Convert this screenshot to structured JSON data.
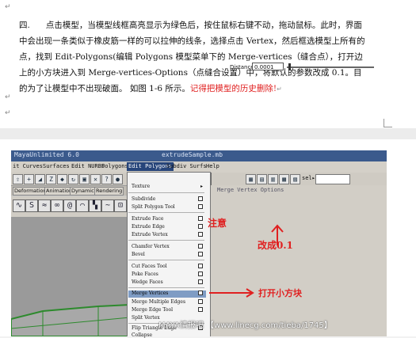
{
  "document": {
    "paragraph_number": "四.",
    "paragraph_text": "点击模型，当模型线框高亮显示为绿色后，按住鼠标右键不动，拖动鼠标。此时，界面中会出现一条类似于橡皮筋一样的可以拉伸的线条，选择点击 Vertex，然后框选模型上所有的点，找到 Edit-Polygons(编辑 Polygons 模型菜单下的 Merge-vertices（缝合点），打开边上的小方块进入到 Merge-vertices-Options（点缝合设置）中，将默认的参数改成 0.1。目的为了让模型中不出现破面。 如图 1-6 所示。",
    "red_note": "记得把模型的历史删除!",
    "return_mark": "↵"
  },
  "maya": {
    "window_title_left": "MayaUnlimited 6.0",
    "window_title_right": "extrudeSample.mb",
    "menus": [
      "it Curves",
      "Surfaces",
      "Edit NURBS",
      "Polygons",
      "Edit Polygons",
      "Subdiv Surfs",
      "Help"
    ],
    "active_menu": "Edit Polygons",
    "shelf_tabs": [
      "Deformation",
      "Animation",
      "Dynamics",
      "Rendering"
    ],
    "sel_label": "sel▸",
    "dialog_title": "Merge Vertex Options",
    "distance_label": "Distance",
    "distance_value": "0.0001",
    "menu_items": [
      {
        "label": "Texture",
        "type": "submenu"
      },
      {
        "label": "Subdivide",
        "type": "option"
      },
      {
        "label": "Split Polygon Tool",
        "type": "option"
      },
      {
        "label": "Extrude Face",
        "type": "option"
      },
      {
        "label": "Extrude Edge",
        "type": "option"
      },
      {
        "label": "Extrude Vertex",
        "type": "option"
      },
      {
        "label": "Chamfer Vertex",
        "type": "option"
      },
      {
        "label": "Bevel",
        "type": "option"
      },
      {
        "label": "Cut Faces Tool",
        "type": "option"
      },
      {
        "label": "Poke Faces",
        "type": "option"
      },
      {
        "label": "Wedge Faces",
        "type": "option"
      },
      {
        "label": "Merge Vertices",
        "type": "option",
        "highlight": true
      },
      {
        "label": "Merge Multiple Edges",
        "type": "option"
      },
      {
        "label": "Merge Edge Tool",
        "type": "option"
      },
      {
        "label": "Split Vertex",
        "type": "plain"
      },
      {
        "label": "Flip Triangle Edge",
        "type": "option"
      },
      {
        "label": "Collapse",
        "type": "plain"
      }
    ]
  },
  "annotations": {
    "note": "注意",
    "change": "改成0.1",
    "open_box": "打开小方块",
    "arrow_color": "#e02020"
  },
  "watermark": "MAYA情报吧 【www.linecg.com/tieba/1745】"
}
